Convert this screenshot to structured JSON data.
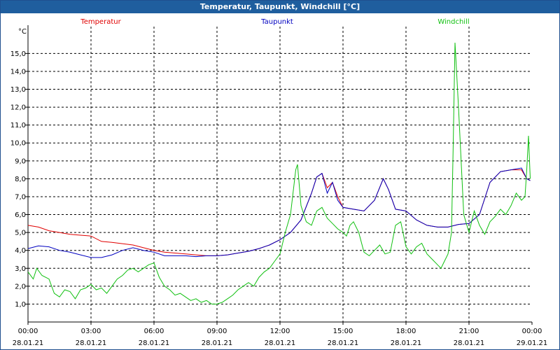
{
  "window": {
    "title": "Temperatur, Taupunkt, Windchill [°C]"
  },
  "chart_data": {
    "type": "line",
    "title": "Temperatur, Taupunkt, Windchill [°C]",
    "ylabel": "°C",
    "ylim": [
      0,
      16.5
    ],
    "xlim_hours": [
      0,
      24
    ],
    "grid": true,
    "y_ticks": [
      "1,0",
      "2,0",
      "3,0",
      "4,0",
      "5,0",
      "6,0",
      "7,0",
      "8,0",
      "9,0",
      "10,0",
      "11,0",
      "12,0",
      "13,0",
      "14,0",
      "15,0"
    ],
    "x_ticks": [
      {
        "time": "00:00",
        "date": "28.01.21"
      },
      {
        "time": "03:00",
        "date": "28.01.21"
      },
      {
        "time": "06:00",
        "date": "28.01.21"
      },
      {
        "time": "09:00",
        "date": "28.01.21"
      },
      {
        "time": "12:00",
        "date": "28.01.21"
      },
      {
        "time": "15:00",
        "date": "28.01.21"
      },
      {
        "time": "18:00",
        "date": "28.01.21"
      },
      {
        "time": "21:00",
        "date": "28.01.21"
      },
      {
        "time": "00:00",
        "date": "29.01.21"
      }
    ],
    "series": [
      {
        "name": "Temperatur",
        "color": "#e00000",
        "x": [
          "00:00",
          "00:30",
          "01:00",
          "01:30",
          "02:00",
          "02:30",
          "03:00",
          "03:30",
          "04:00",
          "05:00",
          "06:00",
          "06:30",
          "07:00",
          "07:30",
          "08:00",
          "08:30",
          "09:00",
          "09:30",
          "10:00",
          "10:30",
          "11:00",
          "11:30",
          "12:00",
          "12:30",
          "13:00",
          "13:30",
          "13:45",
          "14:00",
          "14:15",
          "14:30",
          "14:45",
          "15:00",
          "15:30",
          "16:00",
          "16:30",
          "16:55",
          "17:10",
          "17:30",
          "18:00",
          "18:30",
          "19:00",
          "19:30",
          "20:00",
          "20:30",
          "21:00",
          "21:30",
          "22:00",
          "22:30",
          "23:00",
          "23:30",
          "23:45",
          "23:55"
        ],
        "y": [
          5.4,
          5.3,
          5.1,
          5.0,
          4.9,
          4.85,
          4.8,
          4.5,
          4.45,
          4.3,
          4.0,
          3.9,
          3.85,
          3.8,
          3.75,
          3.7,
          3.7,
          3.75,
          3.85,
          3.95,
          4.1,
          4.3,
          4.6,
          5.0,
          5.7,
          7.2,
          8.1,
          8.3,
          7.5,
          7.8,
          7.0,
          6.4,
          6.3,
          6.2,
          6.8,
          8.0,
          7.4,
          6.3,
          6.2,
          5.7,
          5.4,
          5.3,
          5.3,
          5.45,
          5.5,
          6.0,
          7.8,
          8.4,
          8.5,
          8.5,
          8.0,
          7.9
        ]
      },
      {
        "name": "Taupunkt",
        "color": "#0000c0",
        "x": [
          "00:00",
          "00:30",
          "01:00",
          "01:30",
          "02:00",
          "02:30",
          "03:00",
          "03:30",
          "04:00",
          "04:30",
          "05:00",
          "05:30",
          "06:00",
          "06:30",
          "07:00",
          "07:30",
          "08:00",
          "08:30",
          "09:00",
          "09:30",
          "10:00",
          "10:30",
          "11:00",
          "11:30",
          "12:00",
          "12:30",
          "13:00",
          "13:30",
          "13:45",
          "14:00",
          "14:15",
          "14:30",
          "14:45",
          "15:00",
          "15:30",
          "16:00",
          "16:30",
          "16:55",
          "17:10",
          "17:30",
          "18:00",
          "18:30",
          "19:00",
          "19:30",
          "20:00",
          "20:30",
          "21:00",
          "21:30",
          "22:00",
          "22:30",
          "23:00",
          "23:30",
          "23:45",
          "23:55"
        ],
        "y": [
          4.1,
          4.25,
          4.2,
          4.0,
          3.9,
          3.75,
          3.6,
          3.6,
          3.75,
          4.0,
          4.15,
          4.0,
          3.9,
          3.7,
          3.7,
          3.7,
          3.65,
          3.7,
          3.7,
          3.75,
          3.85,
          3.95,
          4.1,
          4.3,
          4.6,
          5.0,
          5.7,
          7.2,
          8.1,
          8.3,
          7.2,
          7.8,
          6.8,
          6.4,
          6.3,
          6.2,
          6.8,
          8.0,
          7.4,
          6.3,
          6.2,
          5.7,
          5.4,
          5.3,
          5.3,
          5.45,
          5.5,
          6.0,
          7.8,
          8.4,
          8.5,
          8.6,
          8.0,
          7.9
        ]
      },
      {
        "name": "Windchill",
        "color": "#10c010",
        "x": [
          "00:00",
          "00:15",
          "00:25",
          "00:40",
          "01:00",
          "01:15",
          "01:30",
          "01:45",
          "02:00",
          "02:15",
          "02:30",
          "02:45",
          "03:00",
          "03:15",
          "03:30",
          "03:45",
          "04:00",
          "04:15",
          "04:30",
          "04:45",
          "05:00",
          "05:15",
          "05:30",
          "05:45",
          "06:00",
          "06:15",
          "06:30",
          "06:45",
          "07:00",
          "07:15",
          "07:30",
          "07:45",
          "08:00",
          "08:15",
          "08:30",
          "08:45",
          "09:00",
          "09:15",
          "09:30",
          "09:45",
          "10:00",
          "10:15",
          "10:30",
          "10:45",
          "11:00",
          "11:15",
          "11:30",
          "11:45",
          "12:00",
          "12:15",
          "12:30",
          "12:45",
          "12:50",
          "13:00",
          "13:15",
          "13:30",
          "13:45",
          "14:00",
          "14:15",
          "14:30",
          "14:45",
          "15:00",
          "15:10",
          "15:20",
          "15:30",
          "15:45",
          "16:00",
          "16:15",
          "16:30",
          "16:45",
          "17:00",
          "17:15",
          "17:30",
          "17:45",
          "18:00",
          "18:15",
          "18:30",
          "18:45",
          "19:00",
          "19:15",
          "19:30",
          "19:40",
          "19:50",
          "20:00",
          "20:10",
          "20:15",
          "20:20",
          "20:30",
          "20:45",
          "21:00",
          "21:15",
          "21:30",
          "21:45",
          "22:00",
          "22:15",
          "22:30",
          "22:45",
          "23:00",
          "23:15",
          "23:30",
          "23:40",
          "23:45",
          "23:50",
          "23:55"
        ],
        "y": [
          2.8,
          2.4,
          3.0,
          2.6,
          2.4,
          1.6,
          1.4,
          1.8,
          1.7,
          1.3,
          1.8,
          1.9,
          2.1,
          1.8,
          1.9,
          1.6,
          2.0,
          2.4,
          2.6,
          2.9,
          3.0,
          2.8,
          3.0,
          3.2,
          3.3,
          2.5,
          2.0,
          1.8,
          1.5,
          1.6,
          1.4,
          1.2,
          1.3,
          1.1,
          1.2,
          1.0,
          1.0,
          1.1,
          1.3,
          1.5,
          1.8,
          2.0,
          2.2,
          2.0,
          2.5,
          2.8,
          3.0,
          3.4,
          3.8,
          5.0,
          6.0,
          8.5,
          8.8,
          6.5,
          5.6,
          5.4,
          6.2,
          6.4,
          5.8,
          5.5,
          5.2,
          5.0,
          4.8,
          5.4,
          5.6,
          5.0,
          3.9,
          3.7,
          4.0,
          4.3,
          3.8,
          3.9,
          5.4,
          5.6,
          4.2,
          3.8,
          4.2,
          4.4,
          3.8,
          3.5,
          3.2,
          3.0,
          3.4,
          3.8,
          5.0,
          10.0,
          15.6,
          12.0,
          6.0,
          5.0,
          6.2,
          5.4,
          4.9,
          5.6,
          5.9,
          6.3,
          6.0,
          6.5,
          7.2,
          6.8,
          7.0,
          8.5,
          10.4,
          8.0
        ]
      }
    ]
  }
}
